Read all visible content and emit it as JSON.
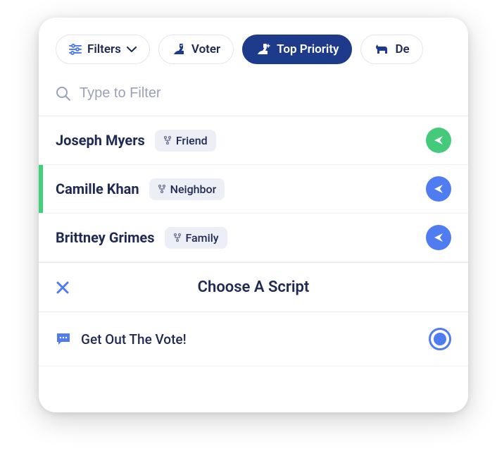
{
  "filters": {
    "label": "Filters",
    "pills": [
      {
        "label": "Voter"
      },
      {
        "label": "Top Priority"
      },
      {
        "label": "De"
      }
    ]
  },
  "search": {
    "placeholder": "Type to Filter"
  },
  "contacts": [
    {
      "name": "Joseph Myers",
      "tag": "Friend",
      "color": "green",
      "highlighted": false
    },
    {
      "name": "Camille Khan",
      "tag": "Neighbor",
      "color": "blue",
      "highlighted": true
    },
    {
      "name": "Brittney Grimes",
      "tag": "Family",
      "color": "blue",
      "highlighted": false
    }
  ],
  "sheet": {
    "title": "Choose A Script",
    "scripts": [
      {
        "label": "Get Out The Vote!",
        "selected": true
      }
    ]
  },
  "colors": {
    "primary_navy": "#1e3a8a",
    "text_navy": "#1e2a52",
    "blue": "#4f7cf0",
    "green": "#45c97b"
  }
}
